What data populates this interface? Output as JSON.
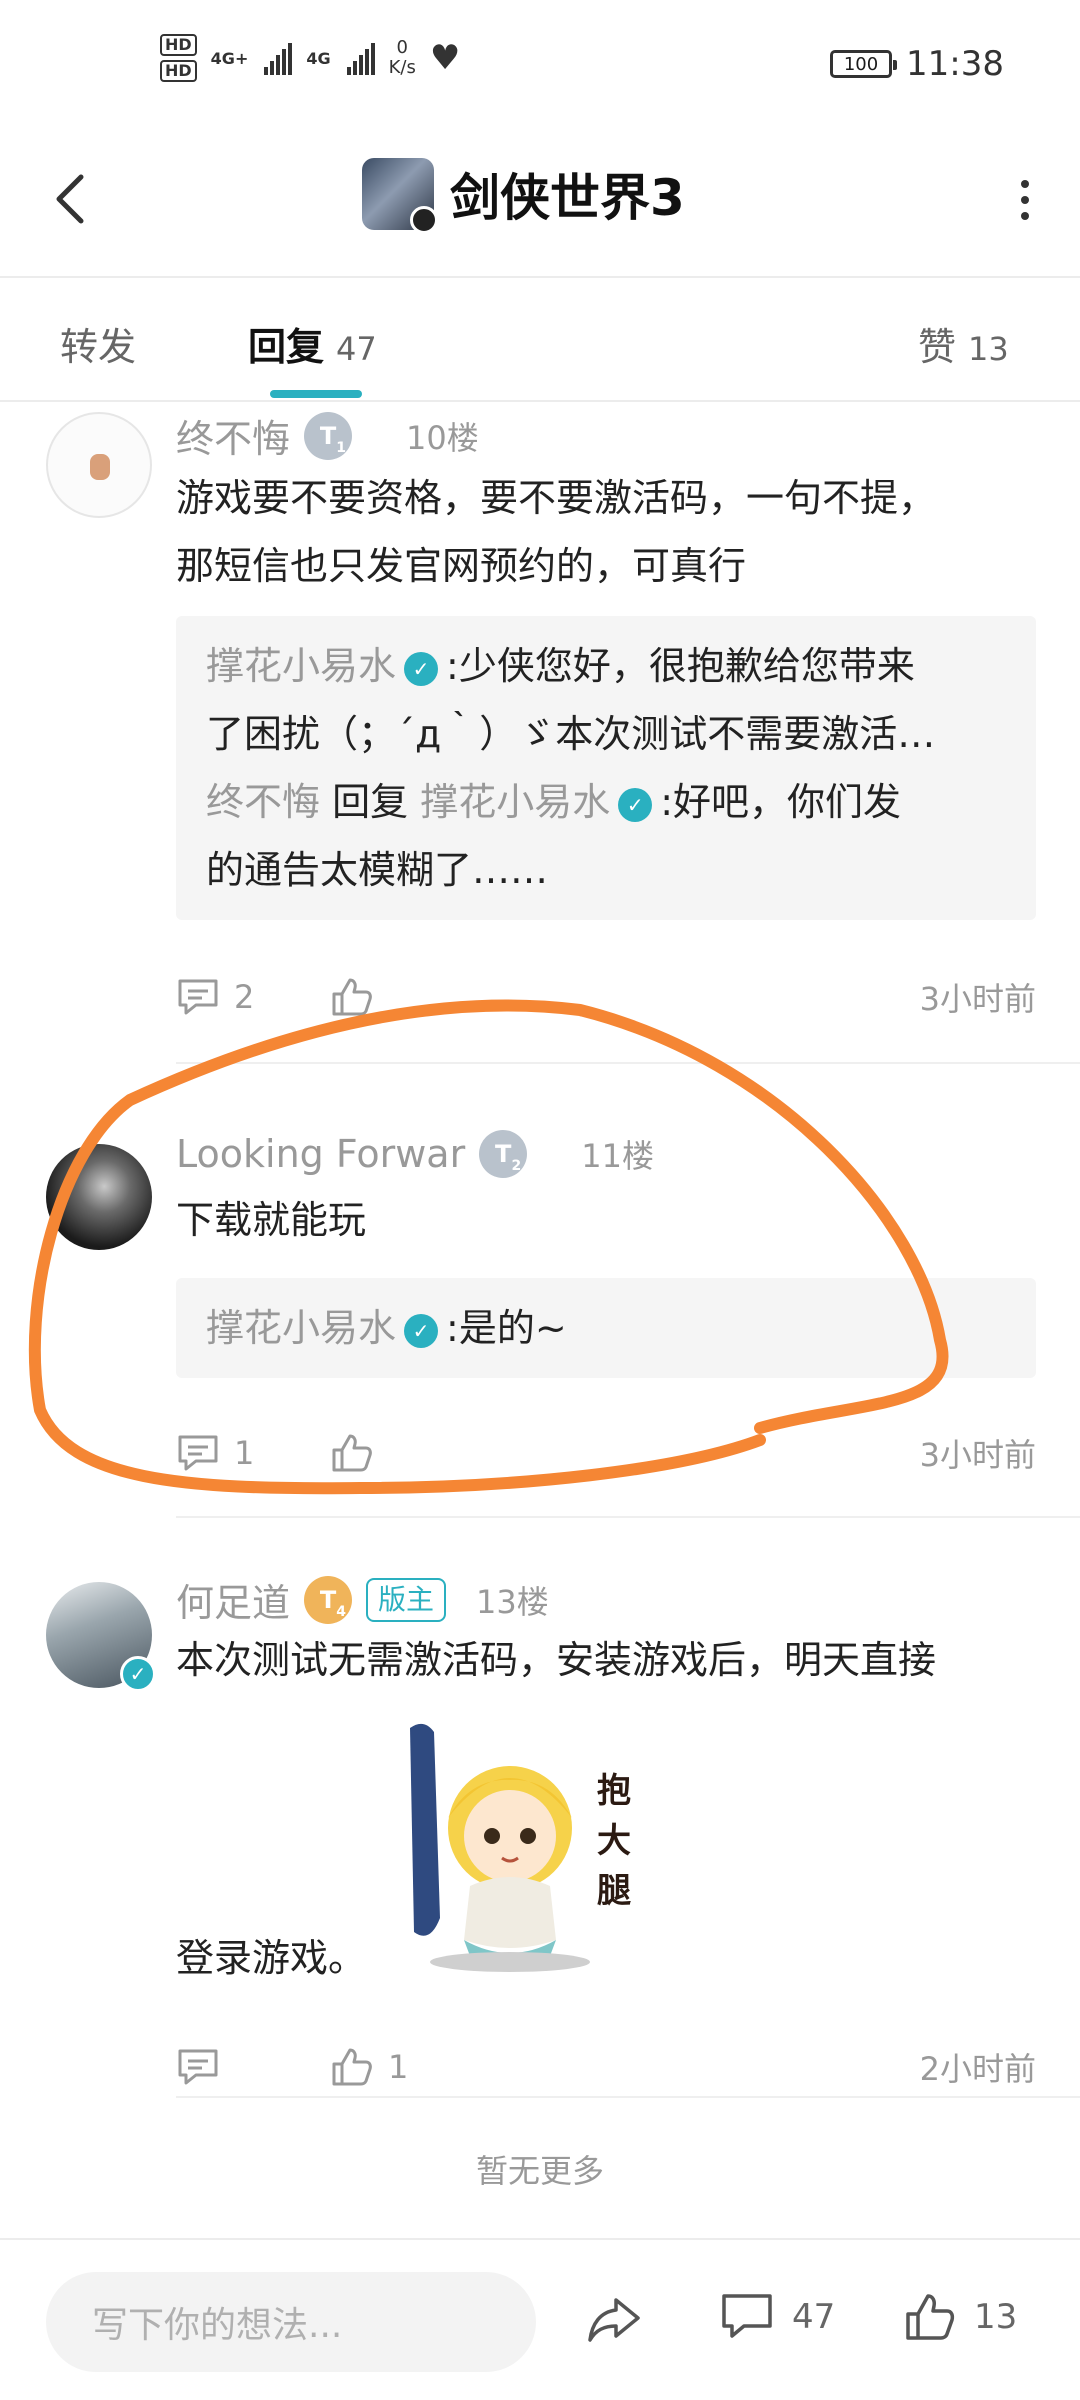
{
  "status_bar": {
    "hd1": "HD",
    "hd2": "HD",
    "net1": "4G+",
    "net2": "4G",
    "speed_value": "0",
    "speed_unit": "K/s",
    "battery": "100",
    "time": "11:38"
  },
  "header": {
    "title": "剑侠世界3",
    "icon": "game-avatar-icon"
  },
  "tabs": [
    {
      "label": "转发",
      "count": ""
    },
    {
      "label": "回复",
      "count": "47"
    },
    {
      "label": "赞",
      "count": "13"
    }
  ],
  "comments": [
    {
      "user": "终不悔",
      "level": "T",
      "level_sub": "1",
      "floor": "10楼",
      "text_lines": [
        "游戏要不要资格，要不要激活码，一句不提，",
        "那短信也只发官网预约的，可真行"
      ],
      "replies": [
        {
          "lines": [
            "撑花小易水",
            ":少侠您好，很抱歉给您带来",
            "了困扰（；´д｀）ゞ本次测试不需要激活…"
          ]
        },
        {
          "from": "终不悔",
          "reply_word": "回复",
          "to": "撑花小易水",
          "lines": [
            ":好吧，你们发",
            "的通告太模糊了……"
          ]
        }
      ],
      "comment_count": "2",
      "like_count": "",
      "time": "3小时前"
    },
    {
      "user": "Looking  Forwar",
      "level": "T",
      "level_sub": "2",
      "floor": "11楼",
      "text_lines": [
        "下载就能玩"
      ],
      "replies": [
        {
          "from": "撑花小易水",
          "text": ":是的~"
        }
      ],
      "comment_count": "1",
      "like_count": "",
      "time": "3小时前"
    },
    {
      "user": "何足道",
      "level": "T",
      "level_sub": "4",
      "tag": "版主",
      "floor": "13楼",
      "text_lines": [
        "本次测试无需激活码，安装游戏后，明天直接",
        "登录游戏。"
      ],
      "sticker_text": "抱大腿",
      "comment_count": "",
      "like_count": "1",
      "time": "2小时前"
    }
  ],
  "footer": {
    "no_more": "暂无更多",
    "input_placeholder": "写下你的想法...",
    "comment_count": "47",
    "like_count": "13"
  },
  "colors": {
    "accent": "#2ab0c0",
    "annotation": "#f58634"
  }
}
